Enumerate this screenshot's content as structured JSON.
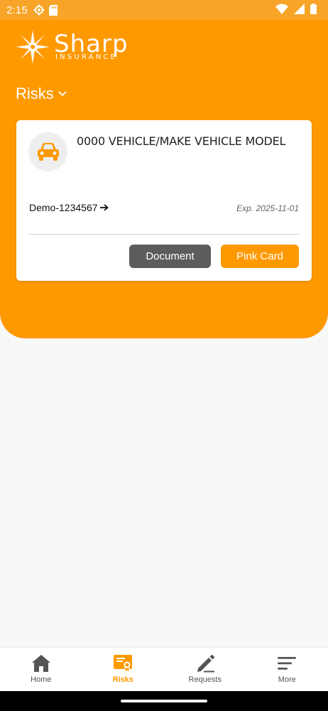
{
  "status_bar": {
    "time": "2:15"
  },
  "logo": {
    "word": "Sharp",
    "sub": "INSURANCE"
  },
  "section": {
    "title": "Risks"
  },
  "card": {
    "vehicle_title": "0000 VEHICLE/MAKE VEHICLE MODEL",
    "policy_number": "Demo-1234567",
    "expiry": "Exp. 2025-11-01",
    "document_label": "Document",
    "pink_card_label": "Pink Card"
  },
  "nav": {
    "items": [
      {
        "label": "Home",
        "icon": "home-icon"
      },
      {
        "label": "Risks",
        "icon": "certificate-icon",
        "active": true
      },
      {
        "label": "Requests",
        "icon": "pencil-icon"
      },
      {
        "label": "More",
        "icon": "menu-icon"
      }
    ]
  },
  "colors": {
    "primary": "#ff9900",
    "status": "#f7a428",
    "document_button": "#5c5c5c"
  }
}
